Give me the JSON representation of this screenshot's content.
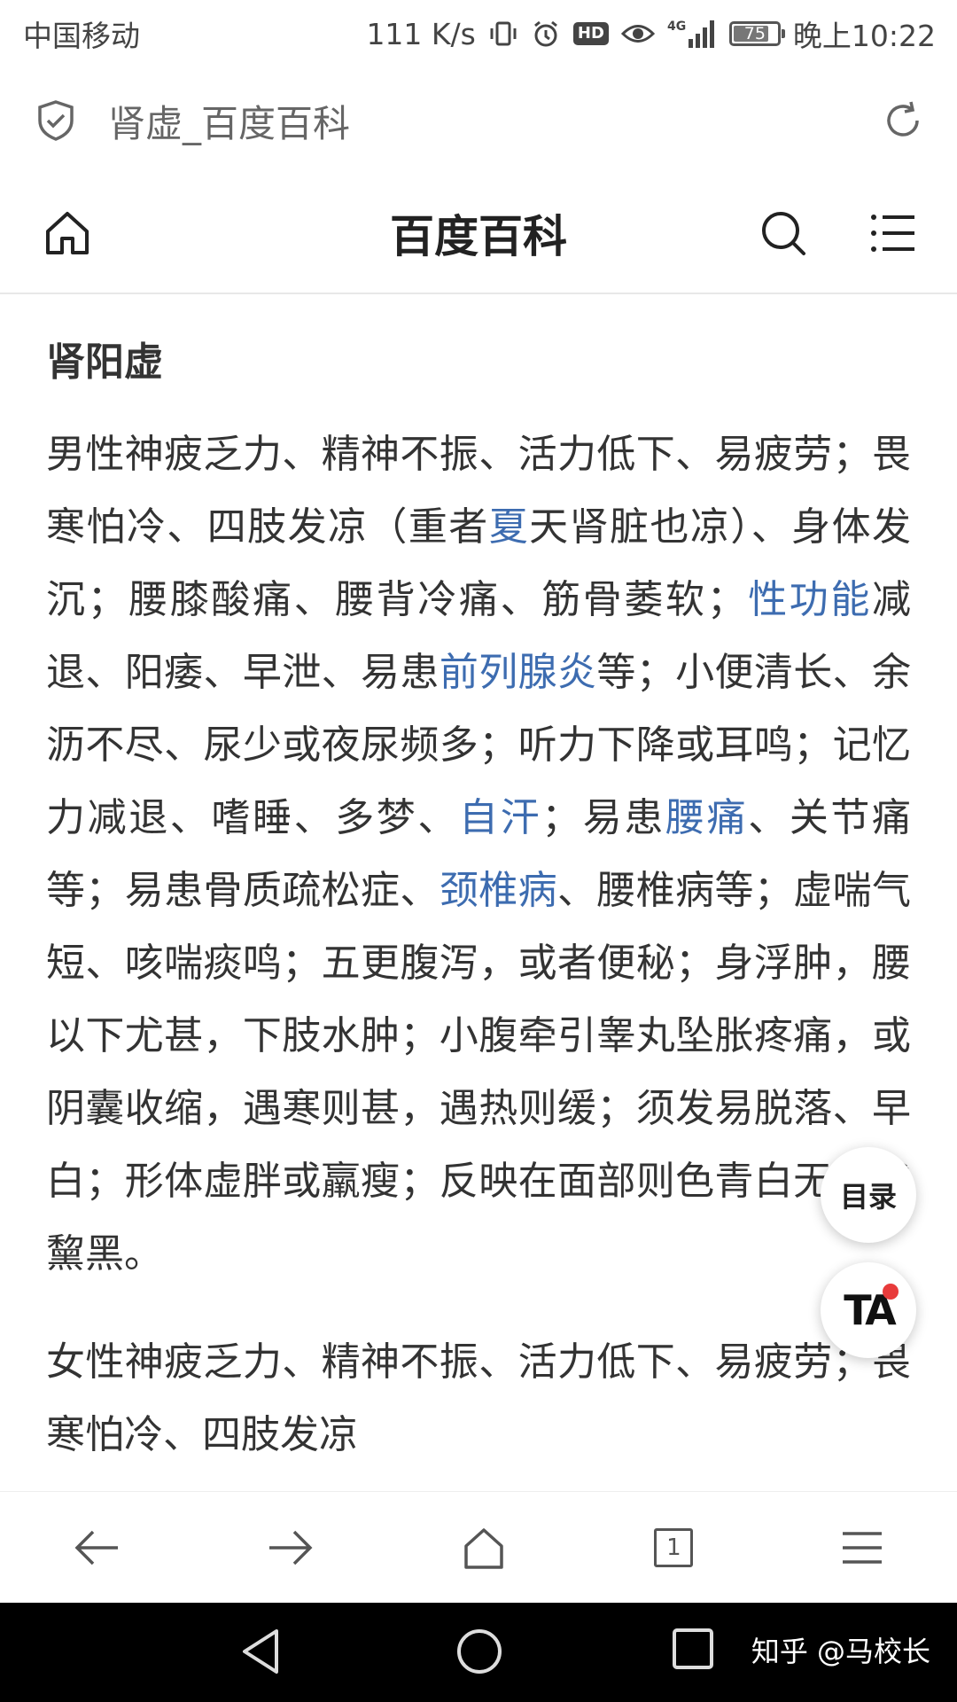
{
  "status_bar": {
    "carrier": "中国移动",
    "speed": "111 K/s",
    "hd": "HD",
    "network": "4G",
    "battery": "75",
    "battery_level": 0.75,
    "time": "晚上10:22"
  },
  "address_bar": {
    "title": "肾虚_百度百科"
  },
  "site_header": {
    "title": "百度百科"
  },
  "content": {
    "section_title": "肾阳虚",
    "paragraphs": {
      "p1": {
        "t1": "男性神疲乏力、精神不振、活力低下、易疲劳；畏寒怕冷、四肢发凉（重者",
        "l1": "夏",
        "t2": "天肾脏也凉）、身体发沉；腰膝酸痛、腰背冷痛、筋骨萎软；",
        "l2": "性功能",
        "t3": "减退、阳痿、早泄、易患",
        "l3": "前列腺炎",
        "t4": "等；小便清长、余沥不尽、尿少或夜尿频多；听力下降或耳鸣；记忆力减退、嗜睡、多梦、",
        "l4": "自汗",
        "t5": "；易患",
        "l5": "腰痛",
        "t6": "、关节痛等；易患骨质疏松症、",
        "l6": "颈椎病",
        "t7": "、腰椎病等；虚喘气短、咳喘痰鸣；五更腹泻，或者便秘；身浮肿，腰以下尤甚，下肢水肿；小腹牵引睾丸坠胀疼痛，或阴囊收缩，遇寒则甚，遇热则缓；须发易脱落、早白；形体虚胖或羸瘦；反映在面部则色青白无光或黧黑。"
      },
      "p2": "女性神疲乏力、精神不振、活力低下、易疲劳；畏寒怕冷、四肢发凉"
    }
  },
  "floating": {
    "toc_label": "目录",
    "ta_label": "TA"
  },
  "browser_nav": {
    "tab_count": "1"
  },
  "watermark": "知乎 @马校长",
  "colors": {
    "link": "#3d6cb0",
    "text": "#333333",
    "badge_dot": "#e83b3b"
  }
}
